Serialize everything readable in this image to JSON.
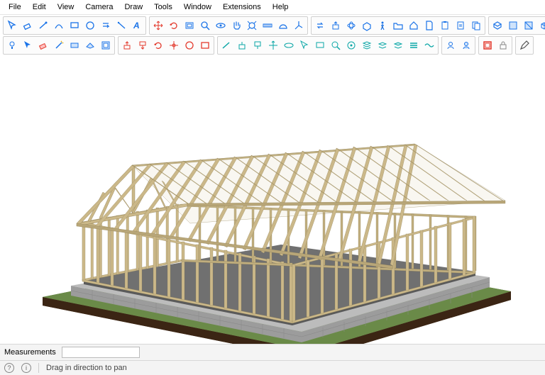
{
  "menu": {
    "items": [
      "File",
      "Edit",
      "View",
      "Camera",
      "Draw",
      "Tools",
      "Window",
      "Extensions",
      "Help"
    ]
  },
  "toolbar": {
    "row1": [
      {
        "group": [
          "select-icon",
          "eraser-icon",
          "line-icon",
          "arc-icon",
          "rect-icon",
          "circle-icon",
          "pushpull-icon",
          "tape-icon",
          "text-icon"
        ]
      },
      {
        "group": [
          "move-icon",
          "rotate-icon",
          "offset-icon",
          "zoom-icon",
          "orbit-icon",
          "pan-icon",
          "zoom-ext-icon",
          "tape2-icon",
          "protractor-icon",
          "axes-icon"
        ]
      },
      {
        "group": [
          "swap-icon",
          "pushpull2-icon",
          "orbit2-icon",
          "section-icon",
          "walk-icon",
          "folder-icon",
          "home-icon",
          "doc-icon",
          "paste-icon",
          "clipboard-icon",
          "clipboard2-icon"
        ]
      },
      {
        "group": [
          "3dw-icon",
          "comp-icon",
          "faces-icon",
          "cube-icon",
          "solid-icon"
        ]
      },
      {
        "group": [
          "geo-icon",
          "box-icon"
        ]
      }
    ],
    "row2": [
      {
        "group": [
          "bulb-icon",
          "select2-icon",
          "eraser2-icon",
          "wand-icon",
          "rect2-icon",
          "plane-icon",
          "offset2-icon"
        ]
      },
      {
        "group": [
          "red-pushpull-u",
          "red-pushpull-d",
          "red-rotate",
          "red-orbit",
          "red-circle",
          "red-rect"
        ]
      },
      {
        "group": [
          "teal-line",
          "teal-push",
          "teal-pull",
          "teal-x",
          "teal-orbit",
          "teal-sel",
          "teal-rect",
          "teal-zoom",
          "teal-center",
          "teal-stack",
          "teal-layers",
          "teal-layers2",
          "teal-layers3",
          "teal-wave"
        ]
      },
      {
        "group": [
          "profile-icon",
          "profile2-icon"
        ]
      },
      {
        "group": [
          "redbox-icon",
          "lock-icon"
        ]
      },
      {
        "group": [
          "pencil-icon"
        ]
      }
    ]
  },
  "status": {
    "measurements_label": "Measurements",
    "measurements_value": "",
    "hint": "Drag in direction to pan",
    "ctx_icon": "?",
    "info_icon": "i"
  },
  "colors": {
    "primary": "#1a73e8",
    "accent_red": "#e33b2e",
    "accent_teal": "#0aa6a6",
    "wood": "#cbb889",
    "wood_dark": "#a89868",
    "slab": "#6a6a6a",
    "block": "#b9b9b9",
    "soil": "#4a2f1a",
    "grass": "#5a7a3a"
  }
}
